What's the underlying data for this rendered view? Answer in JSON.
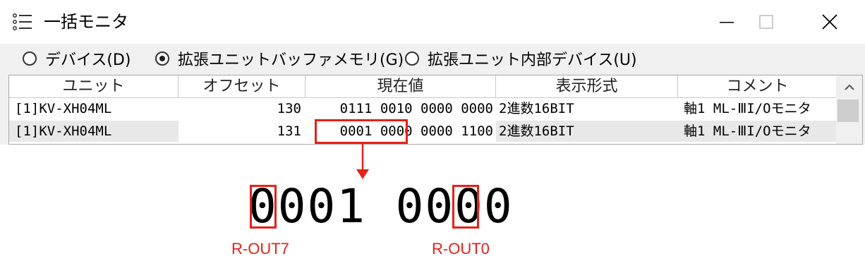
{
  "window": {
    "title": "一括モニタ",
    "app_icon": "list-icon"
  },
  "radios": [
    {
      "label": "デバイス(D)",
      "checked": false
    },
    {
      "label": "拡張ユニットバッファメモリ(G)",
      "checked": true
    },
    {
      "label": "拡張ユニット内部デバイス(U)",
      "checked": false
    }
  ],
  "grid": {
    "headers": [
      "ユニット",
      "オフセット",
      "現在値",
      "表示形式",
      "コメント"
    ],
    "rows": [
      {
        "unit": "[1]KV-XH04ML",
        "offset": "130",
        "value": "0111 0010 0000 0000",
        "format": "2進数16BIT",
        "comment": "軸1 ML-ⅢI/Oモニタ"
      },
      {
        "unit": "[1]KV-XH04ML",
        "offset": "131",
        "value": "0001 0000 0000 1100",
        "format": "2進数16BIT",
        "comment": "軸1 ML-ⅢI/Oモニタ"
      }
    ]
  },
  "zoom": {
    "value": "0001 0000",
    "label_left": "R-OUT7",
    "label_right": "R-OUT0"
  },
  "colors": {
    "highlight": "#e62117"
  }
}
